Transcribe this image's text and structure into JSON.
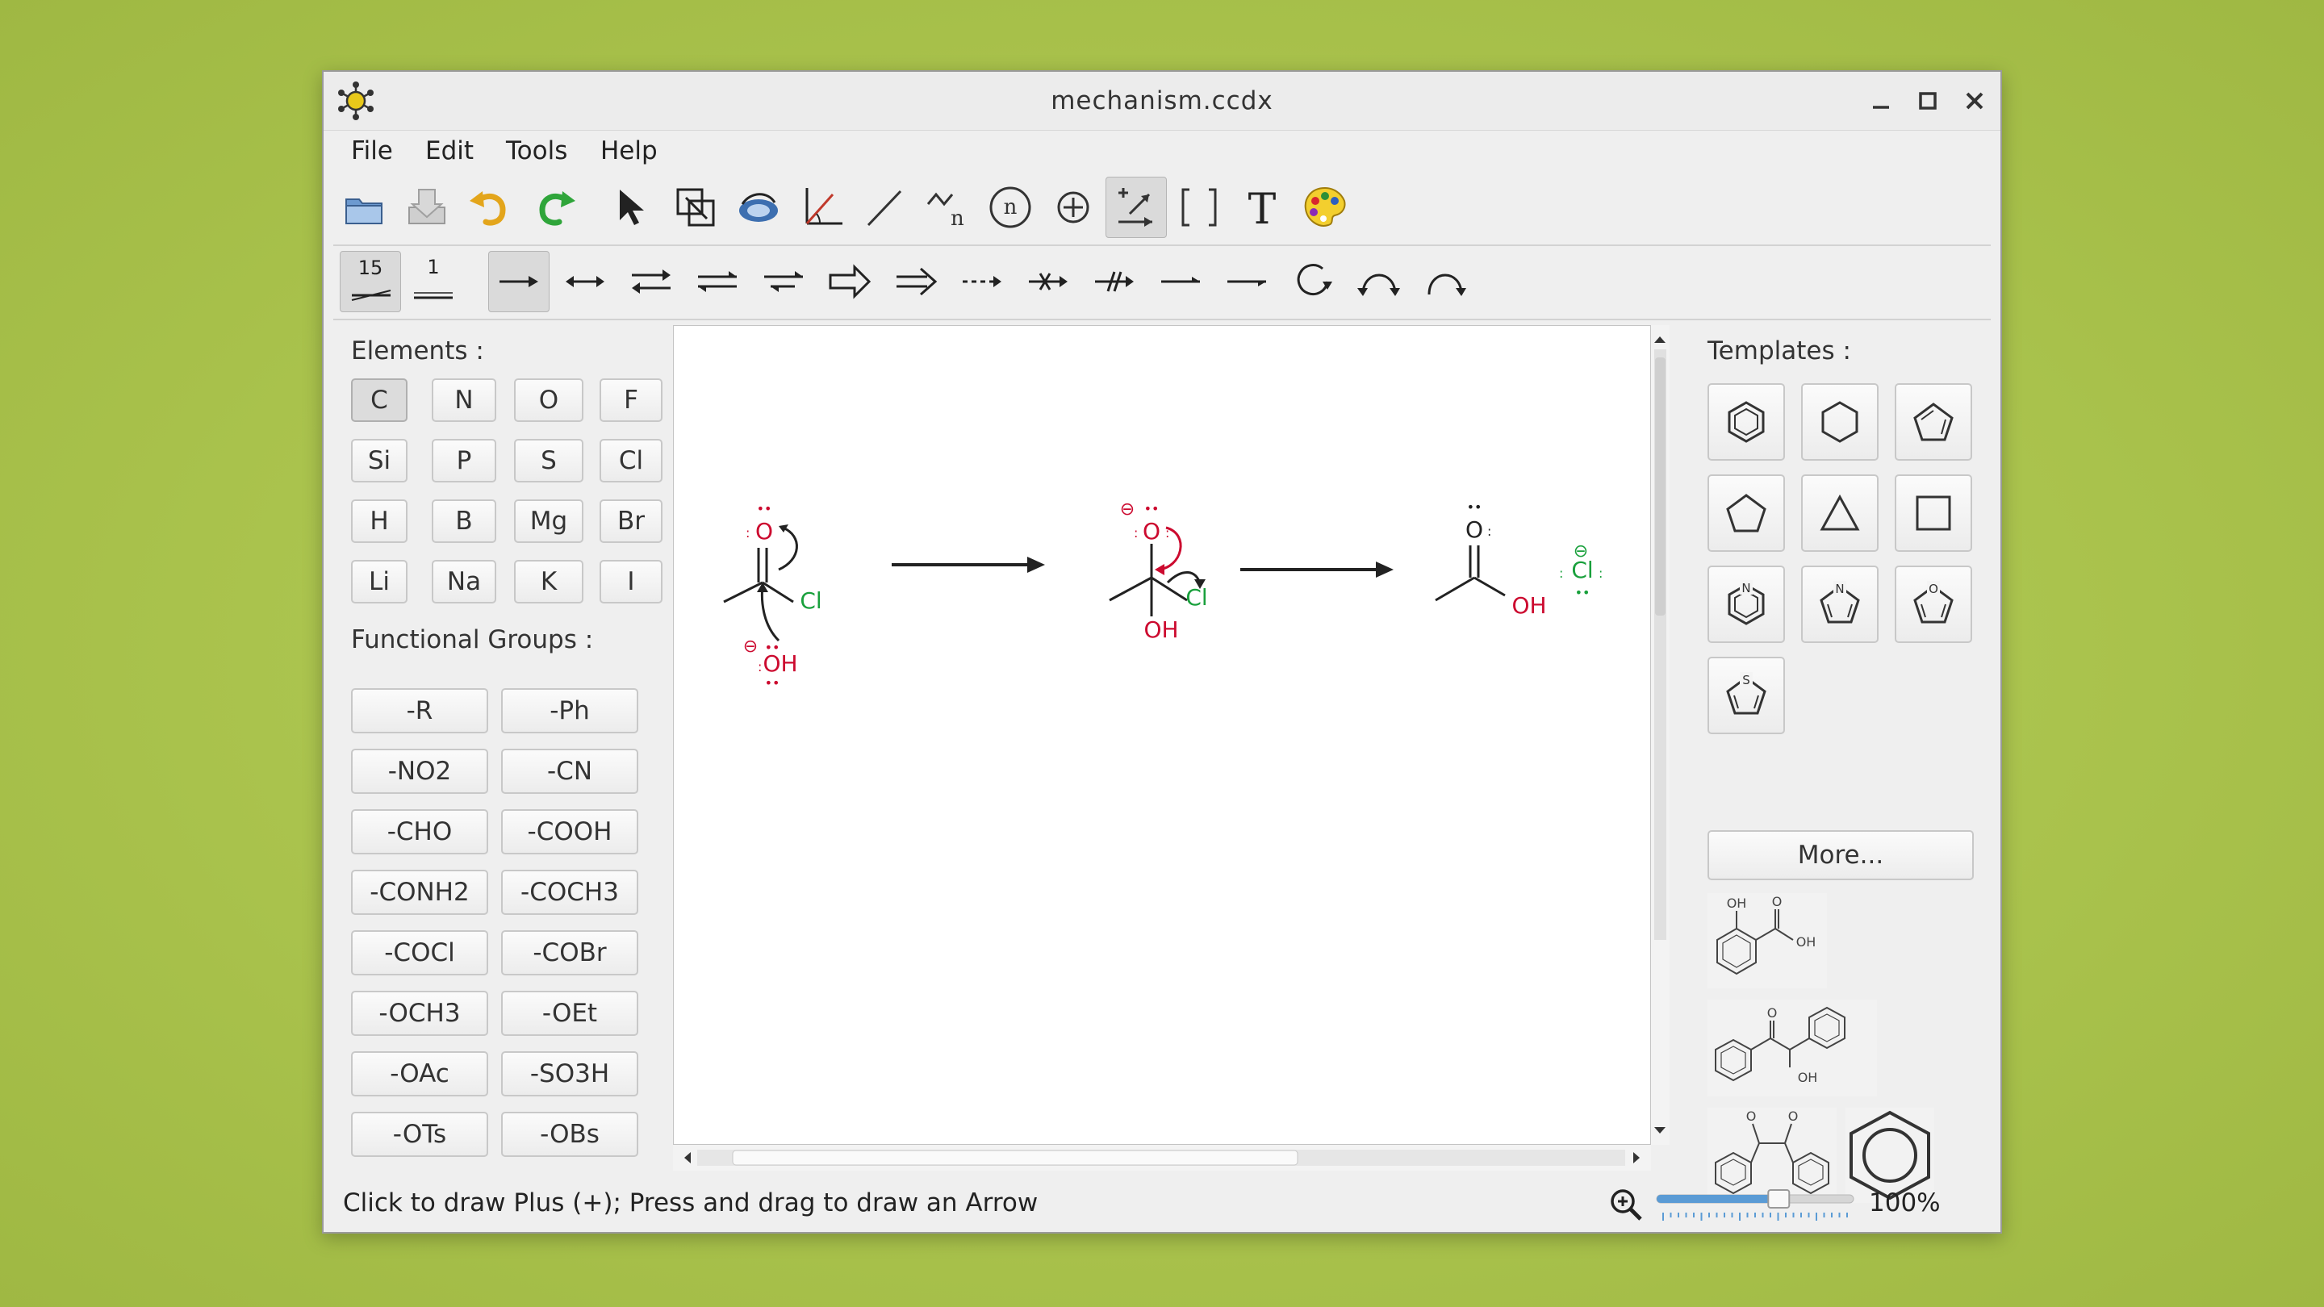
{
  "window": {
    "title": "mechanism.ccdx"
  },
  "menu": [
    "File",
    "Edit",
    "Tools",
    "Help"
  ],
  "toolbar_main": [
    "open-icon",
    "save-icon",
    "undo-icon",
    "redo-icon",
    "select-arrow-icon",
    "resize-icon",
    "rotate-icon",
    "angle-icon",
    "bond-line-icon",
    "chain-icon",
    "n-circle-icon",
    "plus-circle-icon",
    "reaction-arrow-tool-icon",
    "bracket-icon",
    "text-icon",
    "palette-icon"
  ],
  "bond_length": {
    "a": "15",
    "b": "1"
  },
  "toolbar_arrows": [
    "single-arrow",
    "double-headed-arrow",
    "equilibrium-arrow",
    "equilibrium-arrow-2",
    "unbalanced-equilibrium-arrow",
    "hollow-arrow",
    "double-line-arrow",
    "dashed-arrow",
    "no-go-arrow",
    "crossed-arrow",
    "half-arrow",
    "half-arrow-2",
    "circle-arrow",
    "curved-arrow-double",
    "curved-arrow-single"
  ],
  "elements": {
    "label": "Elements :",
    "items": [
      "C",
      "N",
      "O",
      "F",
      "Si",
      "P",
      "S",
      "Cl",
      "H",
      "B",
      "Mg",
      "Br",
      "Li",
      "Na",
      "K",
      "I"
    ],
    "selected": "C"
  },
  "functional_groups": {
    "label": "Functional Groups :",
    "items": [
      "-R",
      "-Ph",
      "-NO2",
      "-CN",
      "-CHO",
      "-COOH",
      "-CONH2",
      "-COCH3",
      "-COCl",
      "-COBr",
      "-OCH3",
      "-OEt",
      "-OAc",
      "-SO3H",
      "-OTs",
      "-OBs"
    ]
  },
  "templates": {
    "label": "Templates :",
    "items": [
      "benzene-icon",
      "cyclohexane-icon",
      "cyclopentadiene-icon",
      "cyclopentane-icon",
      "cyclopropane-icon",
      "cyclobutane-icon",
      "pyridine-icon",
      "pyrrole-icon",
      "furan-icon",
      "thiophene-icon"
    ],
    "more": "More..."
  },
  "recent_labels": {
    "oh": "OH",
    "o": "O"
  },
  "chem_labels": {
    "o": "O",
    "cl": "Cl",
    "oh": "OH",
    "minus": "⊖",
    "lone_pair": "••"
  },
  "colors": {
    "accent": "#cc0a2f",
    "green": "#19a03c",
    "text": "#222222"
  },
  "status": "Click to draw Plus (+); Press and drag to draw an Arrow",
  "zoom": {
    "percent": "100%",
    "slider_value": 0.62
  }
}
